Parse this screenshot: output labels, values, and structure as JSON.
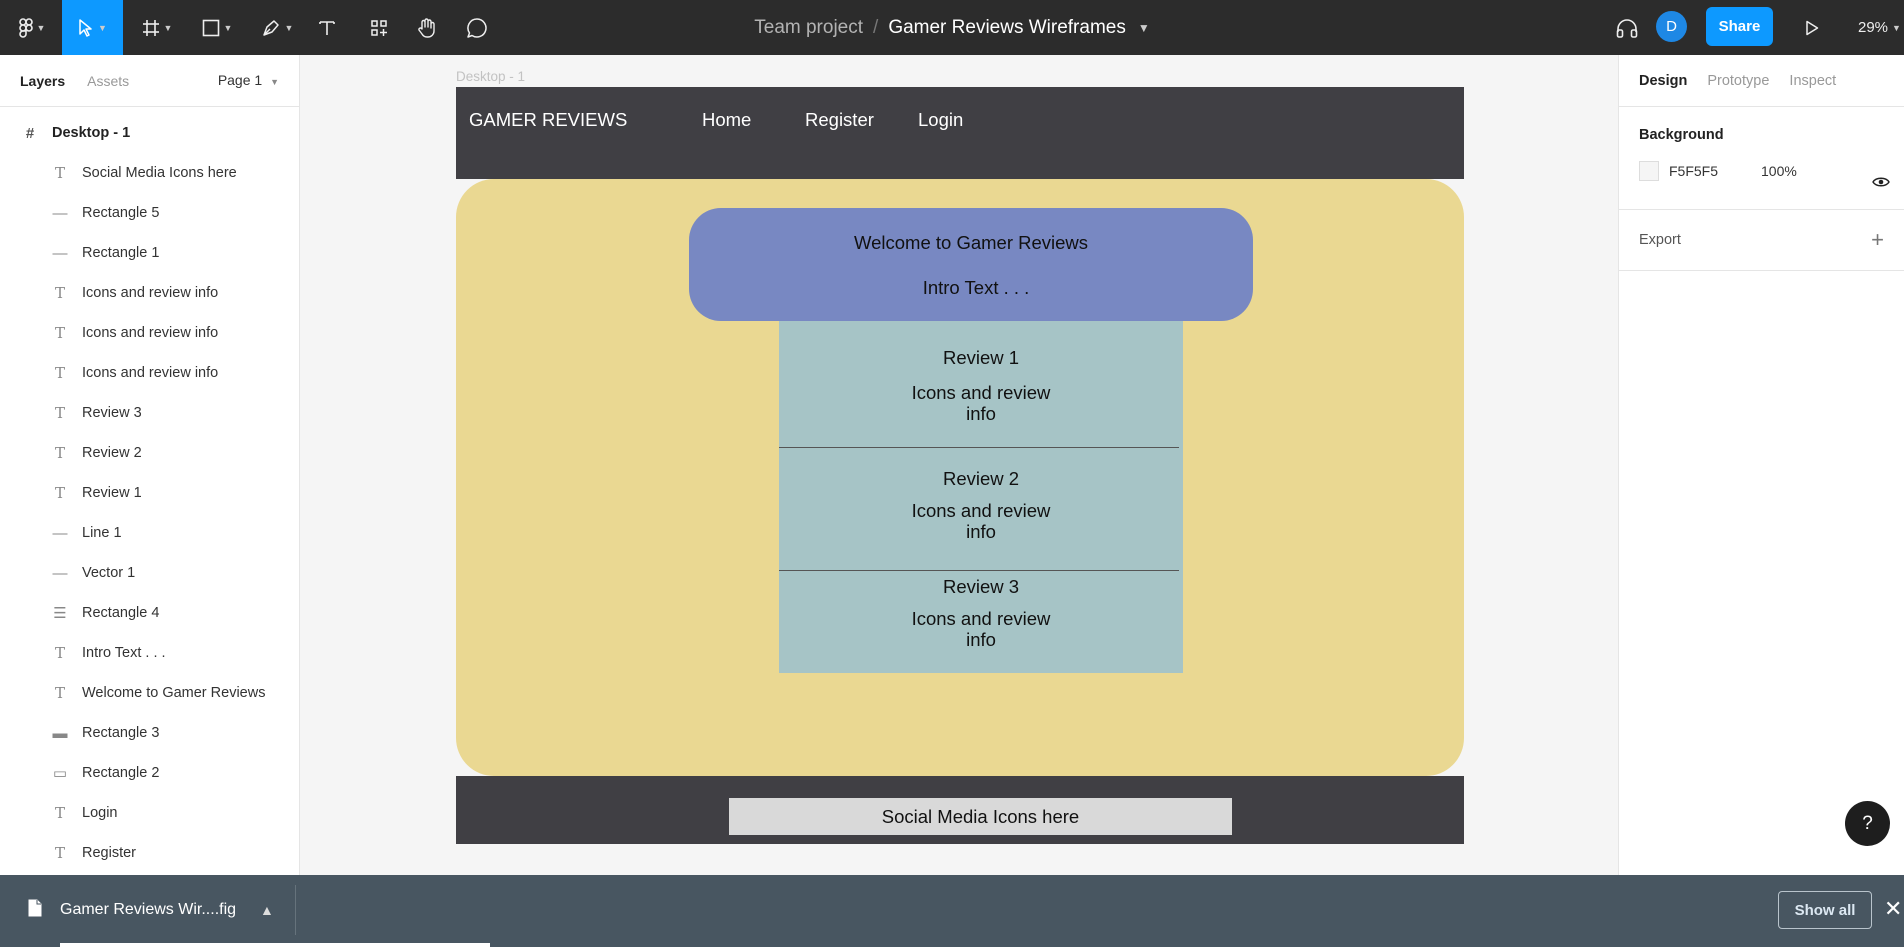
{
  "toolbar": {
    "team": "Team project",
    "separator": "/",
    "file_name": "Gamer Reviews Wireframes",
    "share_label": "Share",
    "avatar_initial": "D",
    "zoom": "29%",
    "accent_color": "#0d99ff"
  },
  "left_panel": {
    "tabs": [
      "Layers",
      "Assets"
    ],
    "page": "Page 1",
    "frame_layer": "Desktop - 1",
    "layers": [
      {
        "icon": "text-icon",
        "label": "Social Media Icons here"
      },
      {
        "icon": "line-icon",
        "label": "Rectangle 5"
      },
      {
        "icon": "line-icon",
        "label": "Rectangle 1"
      },
      {
        "icon": "text-icon",
        "label": "Icons and review info"
      },
      {
        "icon": "text-icon",
        "label": "Icons and review info"
      },
      {
        "icon": "text-icon",
        "label": "Icons and review info"
      },
      {
        "icon": "text-icon",
        "label": "Review 3"
      },
      {
        "icon": "text-icon",
        "label": "Review 2"
      },
      {
        "icon": "text-icon",
        "label": "Review 1"
      },
      {
        "icon": "line-icon",
        "label": "Line 1"
      },
      {
        "icon": "line-icon",
        "label": "Vector 1"
      },
      {
        "icon": "rectangle-stack-icon",
        "label": "Rectangle 4"
      },
      {
        "icon": "text-icon",
        "label": "Intro Text . . ."
      },
      {
        "icon": "text-icon",
        "label": "Welcome to Gamer Reviews"
      },
      {
        "icon": "thick-line-icon",
        "label": "Rectangle 3"
      },
      {
        "icon": "rectangle-icon",
        "label": "Rectangle 2"
      },
      {
        "icon": "text-icon",
        "label": "Login"
      },
      {
        "icon": "text-icon",
        "label": "Register"
      }
    ]
  },
  "right_panel": {
    "tabs": [
      "Design",
      "Prototype",
      "Inspect"
    ],
    "background_title": "Background",
    "background_hex": "F5F5F5",
    "background_opacity": "100%",
    "export_label": "Export",
    "help": "?"
  },
  "canvas": {
    "frame_label": "Desktop - 1",
    "wireframe": {
      "brand": "GAMER REVIEWS",
      "nav": [
        "Home",
        "Register",
        "Login"
      ],
      "welcome_title": "Welcome to Gamer Reviews",
      "intro_text": "Intro Text . . .",
      "reviews": [
        {
          "title": "Review 1",
          "info": "Icons and review info"
        },
        {
          "title": "Review 2",
          "info": "Icons and review info"
        },
        {
          "title": "Review 3",
          "info": "Icons and review info"
        }
      ],
      "footer_text": "Social Media Icons here",
      "colors": {
        "header": "#403f44",
        "body": "#ead892",
        "welcome": "#7888c2",
        "reviews": "#a6c4c6",
        "social": "#d9d9d9"
      }
    }
  },
  "download_bar": {
    "file_name": "Gamer Reviews Wir....fig",
    "show_all_label": "Show all"
  }
}
